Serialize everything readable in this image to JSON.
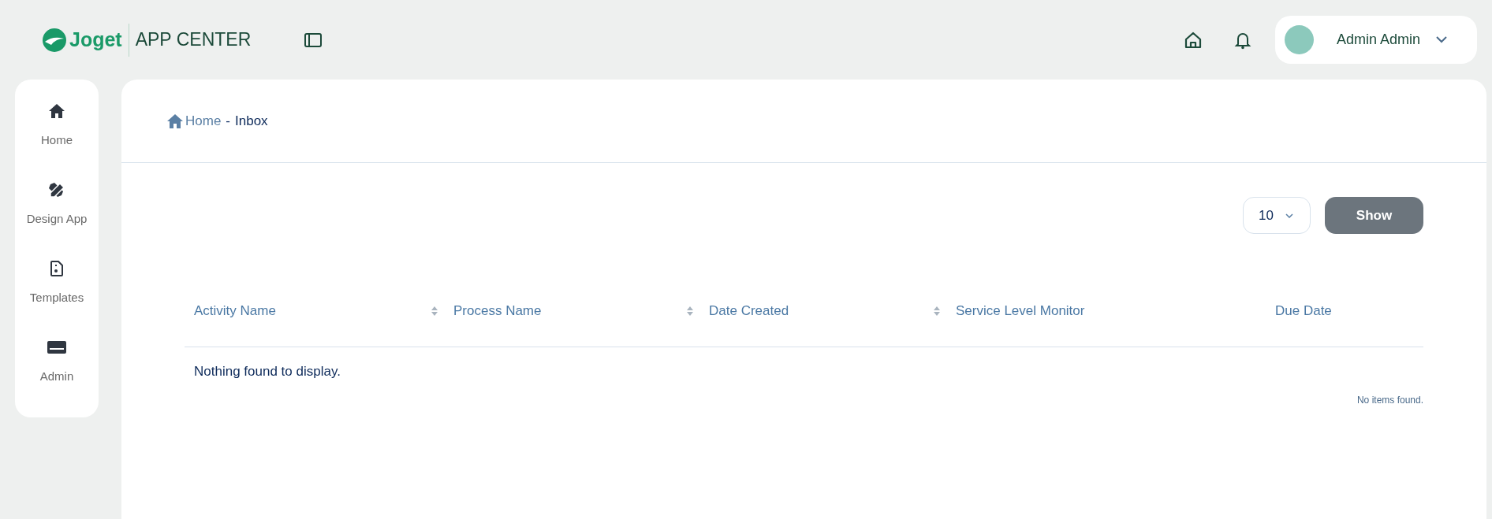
{
  "header": {
    "logo_text": "Joget",
    "app_title": "APP CENTER",
    "user_name": "Admin Admin"
  },
  "sidebar": {
    "items": [
      {
        "label": "Home",
        "kind": "home"
      },
      {
        "label": "Design App",
        "kind": "design"
      },
      {
        "label": "Templates",
        "kind": "templates"
      },
      {
        "label": "Admin",
        "kind": "admin"
      }
    ]
  },
  "breadcrumb": {
    "home": "Home",
    "separator": "-",
    "current": "Inbox"
  },
  "page_size": {
    "value": "10"
  },
  "show_button": "Show",
  "table": {
    "columns": [
      {
        "label": "Activity Name",
        "sortable": true
      },
      {
        "label": "Process Name",
        "sortable": true
      },
      {
        "label": "Date Created",
        "sortable": true
      },
      {
        "label": "Service Level Monitor",
        "sortable": false
      },
      {
        "label": "Due Date",
        "sortable": false
      }
    ],
    "empty_message": "Nothing found to display.",
    "footer_note": "No items found."
  }
}
